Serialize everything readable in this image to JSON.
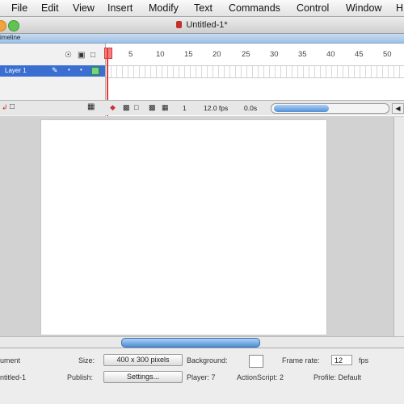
{
  "menu": [
    "File",
    "Edit",
    "View",
    "Insert",
    "Modify",
    "Text",
    "Commands",
    "Control",
    "Window",
    "H"
  ],
  "window": {
    "title": "Untitled-1*"
  },
  "timeline": {
    "panel_label": "imeline",
    "layer_name": "Layer 1",
    "frame_numbers": [
      "1",
      "5",
      "10",
      "15",
      "20",
      "25",
      "30",
      "35",
      "40",
      "45",
      "50"
    ],
    "current_frame": "1",
    "fps": "12.0 fps",
    "elapsed": "0.0s"
  },
  "properties": {
    "doc_type": "ument",
    "doc_name": "ntitled-1",
    "size_label": "Size:",
    "size_value": "400 x 300 pixels",
    "background_label": "Background:",
    "framerate_label": "Frame rate:",
    "framerate_value": "12",
    "fps_unit": "fps",
    "publish_label": "Publish:",
    "settings_label": "Settings...",
    "player": "Player: 7",
    "actionscript": "ActionScript: 2",
    "profile": "Profile: Default"
  },
  "colors": {
    "accent": "#3b6ed1",
    "playhead": "#e23b3b",
    "scroll_thumb": "#4f8fd6"
  }
}
